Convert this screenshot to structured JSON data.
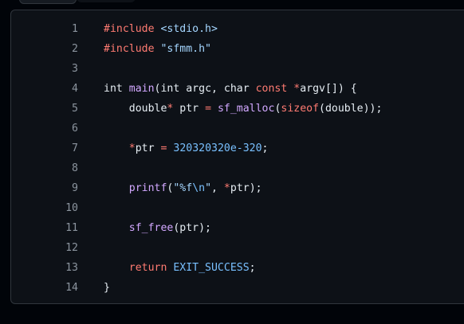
{
  "colors": {
    "background": "#010409",
    "panel": "#0d1117",
    "border": "#30363d",
    "line_number": "#8b949e",
    "text": "#e6edf3",
    "keyword": "#ff7b72",
    "function": "#d2a8ff",
    "string": "#a5d6ff",
    "number": "#79c0ff"
  },
  "code": {
    "lines": [
      {
        "number": "1",
        "tokens": [
          {
            "t": "#include",
            "c": "keyword"
          },
          {
            "t": " ",
            "c": "text"
          },
          {
            "t": "<stdio.h>",
            "c": "string"
          }
        ]
      },
      {
        "number": "2",
        "tokens": [
          {
            "t": "#include",
            "c": "keyword"
          },
          {
            "t": " ",
            "c": "text"
          },
          {
            "t": "\"sfmm.h\"",
            "c": "string"
          }
        ]
      },
      {
        "number": "3",
        "tokens": []
      },
      {
        "number": "4",
        "tokens": [
          {
            "t": "int",
            "c": "text"
          },
          {
            "t": " ",
            "c": "text"
          },
          {
            "t": "main",
            "c": "function"
          },
          {
            "t": "(int argc, char ",
            "c": "text"
          },
          {
            "t": "const",
            "c": "keyword"
          },
          {
            "t": " ",
            "c": "text"
          },
          {
            "t": "*",
            "c": "keyword"
          },
          {
            "t": "argv[]) {",
            "c": "text"
          }
        ]
      },
      {
        "number": "5",
        "tokens": [
          {
            "t": "    double",
            "c": "text"
          },
          {
            "t": "*",
            "c": "keyword"
          },
          {
            "t": " ptr ",
            "c": "text"
          },
          {
            "t": "=",
            "c": "keyword"
          },
          {
            "t": " ",
            "c": "text"
          },
          {
            "t": "sf_malloc",
            "c": "function"
          },
          {
            "t": "(",
            "c": "text"
          },
          {
            "t": "sizeof",
            "c": "keyword"
          },
          {
            "t": "(double));",
            "c": "text"
          }
        ]
      },
      {
        "number": "6",
        "tokens": []
      },
      {
        "number": "7",
        "tokens": [
          {
            "t": "    ",
            "c": "text"
          },
          {
            "t": "*",
            "c": "keyword"
          },
          {
            "t": "ptr ",
            "c": "text"
          },
          {
            "t": "=",
            "c": "keyword"
          },
          {
            "t": " ",
            "c": "text"
          },
          {
            "t": "320320320e-320",
            "c": "number"
          },
          {
            "t": ";",
            "c": "text"
          }
        ]
      },
      {
        "number": "8",
        "tokens": []
      },
      {
        "number": "9",
        "tokens": [
          {
            "t": "    ",
            "c": "text"
          },
          {
            "t": "printf",
            "c": "function"
          },
          {
            "t": "(",
            "c": "text"
          },
          {
            "t": "\"%f",
            "c": "string"
          },
          {
            "t": "\\n",
            "c": "number"
          },
          {
            "t": "\"",
            "c": "string"
          },
          {
            "t": ", ",
            "c": "text"
          },
          {
            "t": "*",
            "c": "keyword"
          },
          {
            "t": "ptr);",
            "c": "text"
          }
        ]
      },
      {
        "number": "10",
        "tokens": []
      },
      {
        "number": "11",
        "tokens": [
          {
            "t": "    ",
            "c": "text"
          },
          {
            "t": "sf_free",
            "c": "function"
          },
          {
            "t": "(ptr);",
            "c": "text"
          }
        ]
      },
      {
        "number": "12",
        "tokens": []
      },
      {
        "number": "13",
        "tokens": [
          {
            "t": "    ",
            "c": "text"
          },
          {
            "t": "return",
            "c": "keyword"
          },
          {
            "t": " ",
            "c": "text"
          },
          {
            "t": "EXIT_SUCCESS",
            "c": "number"
          },
          {
            "t": ";",
            "c": "text"
          }
        ]
      },
      {
        "number": "14",
        "tokens": [
          {
            "t": "}",
            "c": "text"
          }
        ]
      }
    ]
  }
}
